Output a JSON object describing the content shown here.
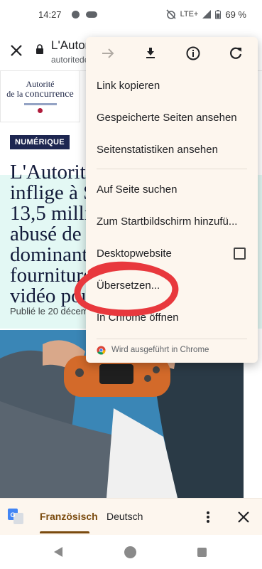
{
  "status": {
    "time": "14:27",
    "network": "LTE+",
    "battery": "69 %"
  },
  "urlbar": {
    "title": "L'Autorit",
    "domain": "autoritede",
    "close_icon": "close-icon",
    "lock_icon": "lock-icon"
  },
  "page": {
    "logo_line1": "Autorité",
    "logo_line2_prefix": "de la",
    "logo_line2_main": "concurrence",
    "tag": "NUMÉRIQUE",
    "headline": [
      "L'Autorité",
      "inflige à S",
      "13,5 million",
      "abusé de s",
      "dominant",
      "fourniture",
      "vidéo pou"
    ],
    "published": "Publié le 20 décem"
  },
  "menu": {
    "top_icons": [
      "arrow-forward-icon",
      "download-icon",
      "info-icon",
      "refresh-icon"
    ],
    "items": [
      {
        "label": "Link kopieren"
      },
      {
        "label": "Gespeicherte Seiten ansehen"
      },
      {
        "label": "Seitenstatistiken ansehen"
      },
      {
        "label": "Auf Seite suchen"
      },
      {
        "label": "Zum Startbildschirm hinzufü..."
      },
      {
        "label": "Desktopwebsite"
      },
      {
        "label": "Übersetzen..."
      },
      {
        "label": "In Chrome öffnen"
      }
    ],
    "desktop_checked": false,
    "footer": "Wird ausgeführt in Chrome"
  },
  "translate": {
    "source_lang": "Französisch",
    "target_lang": "Deutsch"
  },
  "colors": {
    "menu_bg": "#fdf6ee",
    "tag_bg": "#1d2650",
    "annotation": "#e8383d",
    "translate_accent": "#7a4a0e"
  }
}
